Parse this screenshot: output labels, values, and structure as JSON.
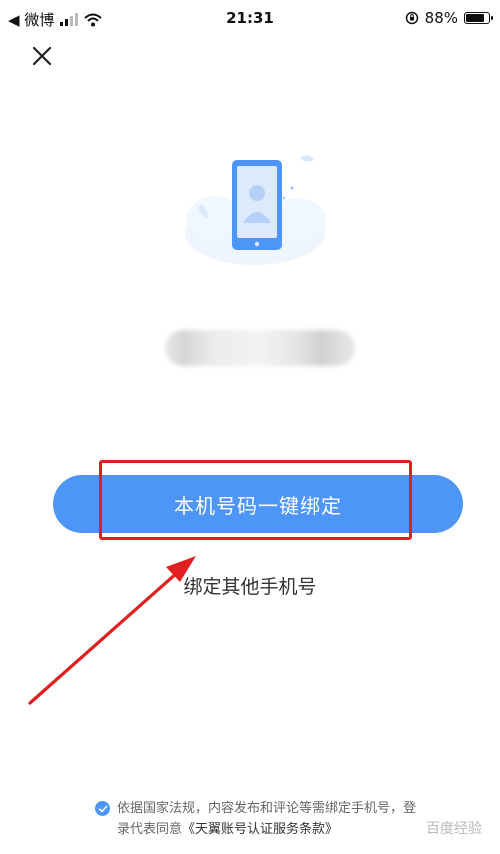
{
  "status_bar": {
    "back_app": "◀ 微博",
    "time": "21:31",
    "battery_text": "88%",
    "battery_level": 0.88
  },
  "illustration": {
    "icon": "phone-user-icon"
  },
  "blurred_phone": "",
  "primary_button": {
    "label": "本机号码一键绑定"
  },
  "secondary_link": {
    "label": "绑定其他手机号"
  },
  "agreement": {
    "checked": true,
    "text": "依据国家法规，内容发布和评论等需绑定手机号，登录代表同意",
    "link": "《天翼账号认证服务条款》"
  },
  "watermark": "百度经验",
  "colors": {
    "accent": "#4d95f7",
    "highlight": "#e02020"
  }
}
